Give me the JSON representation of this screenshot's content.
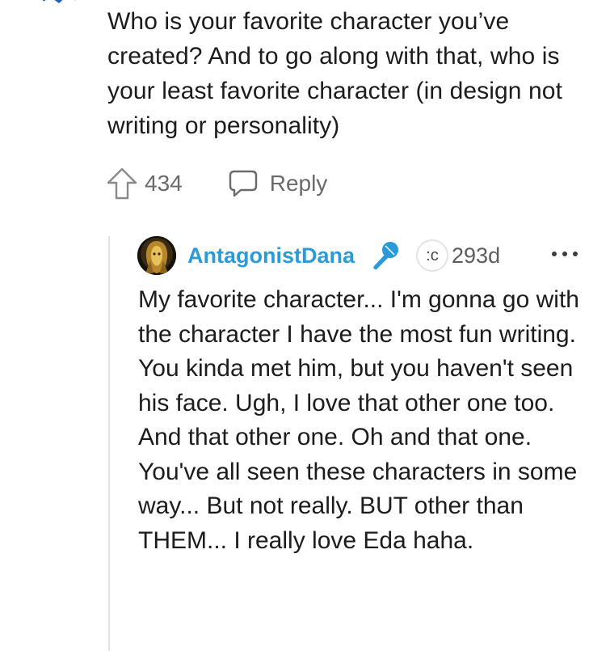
{
  "parent_comment": {
    "text": "Who is your favorite character you’ve created? And to go along with that, who is your least favorite character (in design not writing or personality)",
    "upvote_count": "434",
    "reply_label": "Reply"
  },
  "reply": {
    "username": "AntagonistDana",
    "username_color": "#2b9bd8",
    "author_badge_icon": "microphone-icon",
    "flair": ":c",
    "timestamp": "293d",
    "body": "My favorite character... I'm gonna go with the character I have the most fun writing. You kinda met him, but you haven't seen his face. Ugh, I love that other one too. And that other one. Oh and that one. You've all seen these characters in some way... But not really. BUT other than THEM... I really love Eda haha."
  }
}
